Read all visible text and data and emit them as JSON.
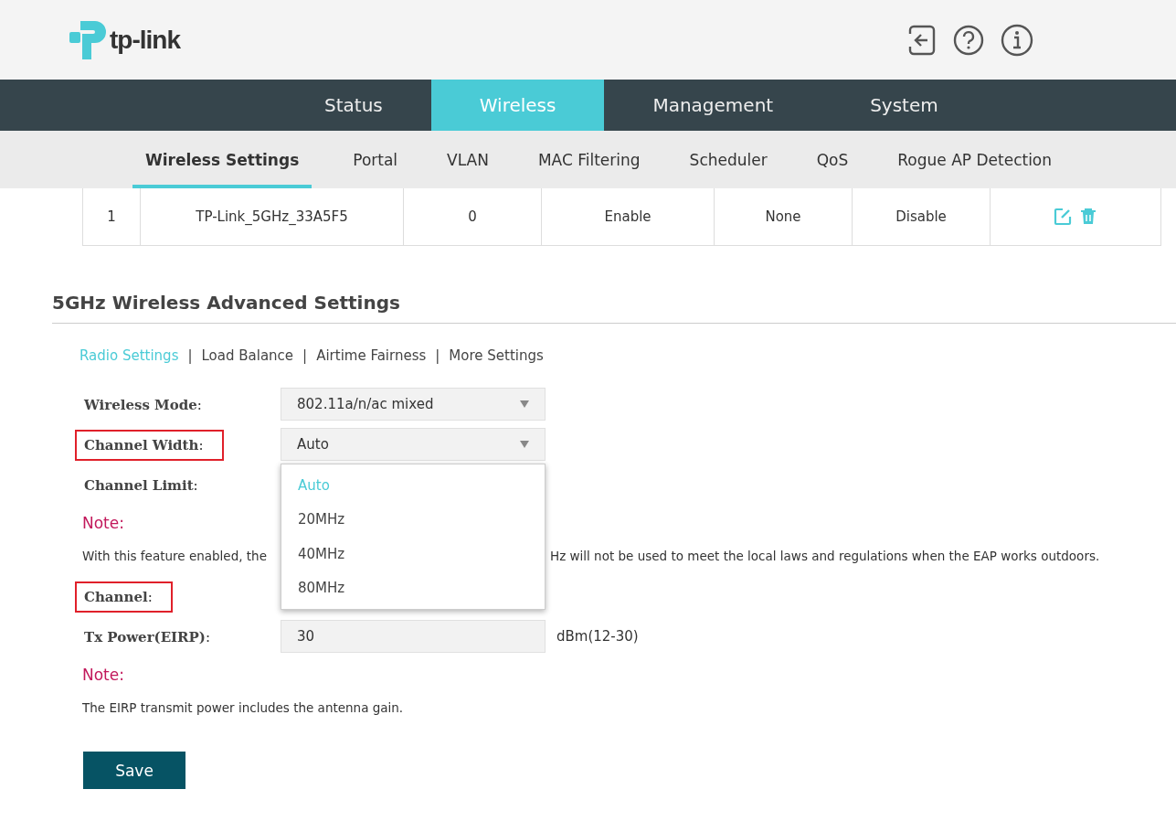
{
  "header": {
    "logo_text": "tp-link"
  },
  "main_tabs": [
    {
      "label": "Status",
      "selected": false
    },
    {
      "label": "Wireless",
      "selected": true
    },
    {
      "label": "Management",
      "selected": false
    },
    {
      "label": "System",
      "selected": false
    }
  ],
  "sub_tabs": [
    {
      "label": "Wireless Settings",
      "selected": true
    },
    {
      "label": "Portal",
      "selected": false
    },
    {
      "label": "VLAN",
      "selected": false
    },
    {
      "label": "MAC Filtering",
      "selected": false
    },
    {
      "label": "Scheduler",
      "selected": false
    },
    {
      "label": "QoS",
      "selected": false
    },
    {
      "label": "Rogue AP Detection",
      "selected": false
    }
  ],
  "table": {
    "rows": [
      {
        "cells": [
          "1",
          "TP-Link_5GHz_33A5F5",
          "0",
          "Enable",
          "None",
          "Disable"
        ]
      }
    ]
  },
  "section": {
    "title": "5GHz Wireless Advanced Settings",
    "links": [
      {
        "label": "Radio Settings",
        "selected": true
      },
      {
        "label": "Load Balance",
        "selected": false
      },
      {
        "label": "Airtime Fairness",
        "selected": false
      },
      {
        "label": "More Settings",
        "selected": false
      }
    ],
    "separator": "|",
    "form": [
      {
        "kind": "select",
        "label": "**Wireless Mode**:",
        "value": "802.11a/n/ac mixed",
        "highlighted": false
      },
      {
        "kind": "select",
        "label": "**Channel Width**:",
        "value": "Auto",
        "highlighted": true,
        "options": [
          {
            "label": "Auto",
            "selected": true
          },
          {
            "label": "20MHz",
            "selected": false
          },
          {
            "label": "40MHz",
            "selected": false
          },
          {
            "label": "80MHz",
            "selected": false
          }
        ]
      },
      {
        "kind": "covered",
        "label": "**Channel Limit**:",
        "highlighted": false
      },
      {
        "kind": "note",
        "title": "Note:",
        "text_start": "With this feature enabled, the",
        "text_end": "Hz will not be used to meet the local laws and regulations when the EAP works outdoors."
      },
      {
        "kind": "covered",
        "label": "**Channel**:",
        "highlighted": true
      },
      {
        "kind": "input",
        "label": "**Tx Power(EIRP)**:",
        "value": "30",
        "suffix": "dBm(12-30)",
        "highlighted": false
      },
      {
        "kind": "note",
        "title": "Note:",
        "text_start": "The EIRP transmit power includes the antenna gain."
      }
    ],
    "save": "Save"
  }
}
